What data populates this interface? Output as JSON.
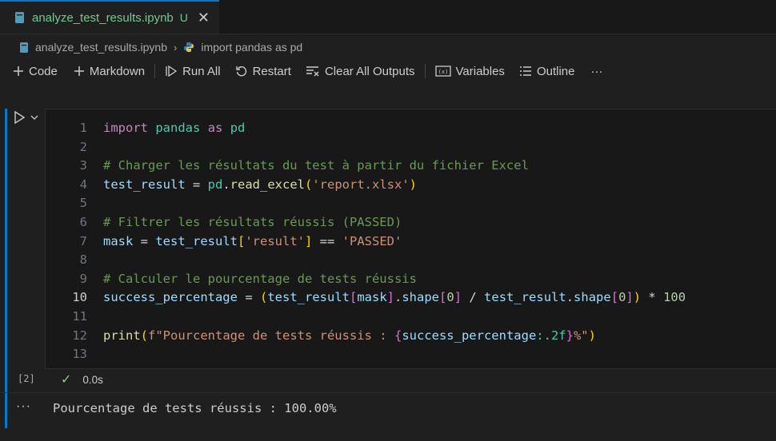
{
  "tab": {
    "title": "analyze_test_results.ipynb",
    "modified_badge": "U",
    "close_glyph": "✕"
  },
  "breadcrumb": {
    "file": "analyze_test_results.ipynb",
    "symbol": "import pandas as pd",
    "separator": "›"
  },
  "toolbar": {
    "code_label": "Code",
    "markdown_label": "Markdown",
    "run_all_label": "Run All",
    "restart_label": "Restart",
    "clear_outputs_label": "Clear All Outputs",
    "variables_label": "Variables",
    "outline_label": "Outline",
    "more_label": "···"
  },
  "cell": {
    "execution_count": "[2]",
    "duration": "0.0s",
    "line_numbers": [
      "1",
      "2",
      "3",
      "4",
      "5",
      "6",
      "7",
      "8",
      "9",
      "10",
      "11",
      "12",
      "13"
    ],
    "active_line": 10,
    "output": "Pourcentage de tests réussis : 100.00%",
    "output_ellipsis": "···"
  },
  "code": {
    "l1": [
      "import",
      "pandas",
      "as",
      "pd"
    ],
    "l3": "# Charger les résultats du test à partir du fichier Excel",
    "l4": [
      "test_result",
      " = ",
      "pd",
      ".",
      "read_excel",
      "(",
      "'report.xlsx'",
      ")"
    ],
    "l6": "# Filtrer les résultats réussis (PASSED)",
    "l7": [
      "mask",
      " = ",
      "test_result",
      "[",
      "'result'",
      "]",
      " == ",
      "'PASSED'"
    ],
    "l9": "# Calculer le pourcentage de tests réussis",
    "l10": [
      "success_percentage",
      " = ",
      "(",
      "test_result",
      "[",
      "mask",
      "]",
      ".",
      "shape",
      "[",
      "0",
      "]",
      " / ",
      "test_result",
      ".",
      "shape",
      "[",
      "0",
      "]",
      ")",
      " * ",
      "100"
    ],
    "l12": [
      "print",
      "(",
      "f\"Pourcentage de tests réussis : ",
      "{",
      "success_percentage",
      ":.2f",
      "}",
      "%\"",
      ")"
    ]
  },
  "colors": {
    "accent": "#0078d4",
    "modified": "#73c991",
    "success": "#89d185"
  }
}
